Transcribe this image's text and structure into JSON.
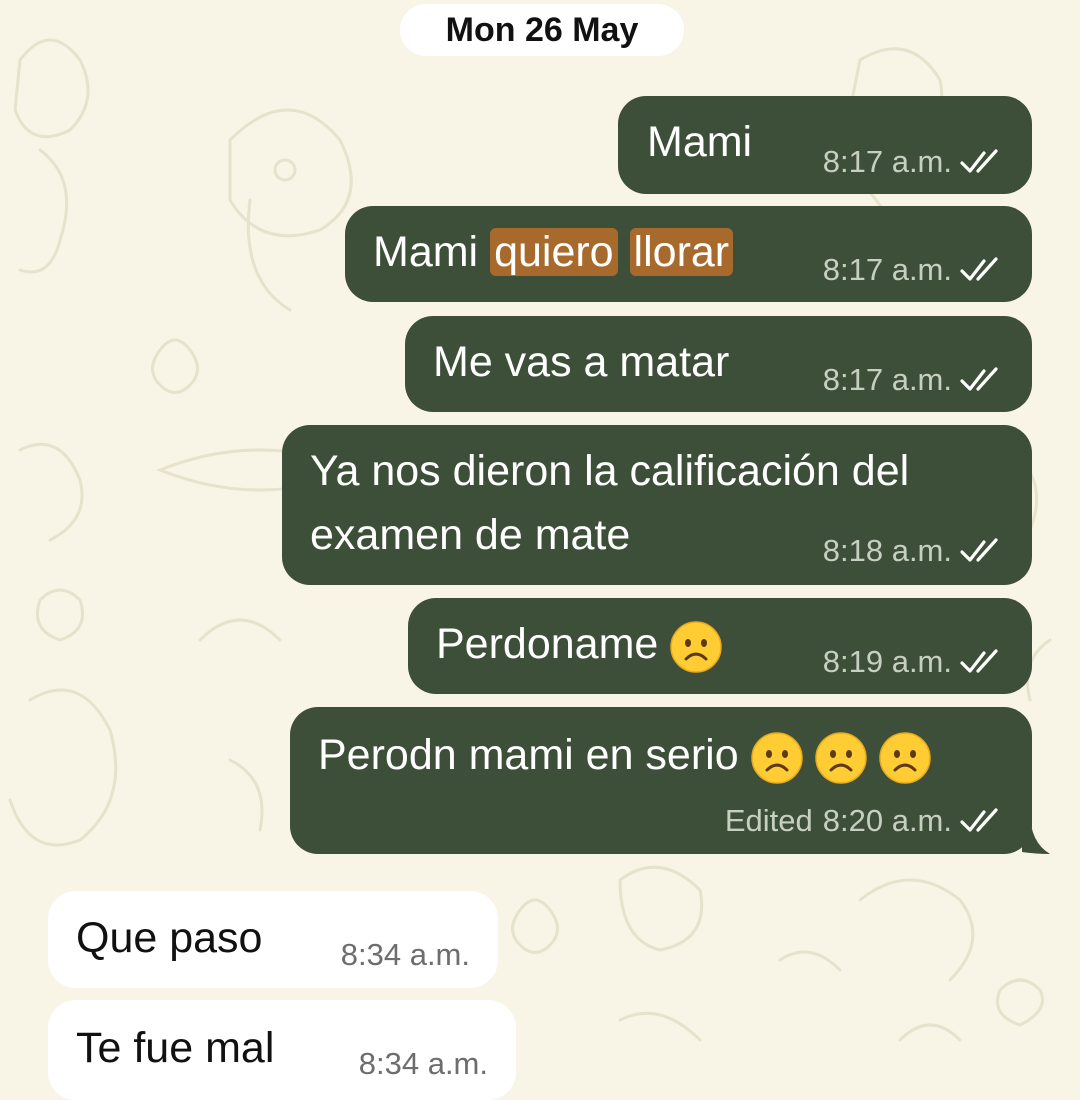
{
  "chat": {
    "date_label": "Mon 26 May",
    "outgoing": [
      {
        "text": "Mami",
        "time": "8:17 a.m.",
        "status": "read-double-check-icon"
      },
      {
        "text_parts": [
          "Mami ",
          "quiero",
          "llorar"
        ],
        "highlighted_words": [
          "quiero",
          "llorar"
        ],
        "time": "8:17 a.m.",
        "status": "read-double-check-icon"
      },
      {
        "text": "Me vas a matar",
        "time": "8:17 a.m.",
        "status": "read-double-check-icon"
      },
      {
        "line1": "Ya nos dieron la calificación del",
        "line2": "examen de mate",
        "time": "8:18 a.m.",
        "status": "read-double-check-icon"
      },
      {
        "text": "Perdoname",
        "emoji": "frowning-face-icon",
        "emoji_count": 1,
        "time": "8:19 a.m.",
        "status": "read-double-check-icon"
      },
      {
        "text": "Perodn mami en serio",
        "emoji": "frowning-face-icon",
        "emoji_count": 3,
        "edited_label": "Edited",
        "time": "8:20 a.m.",
        "status": "read-double-check-icon"
      }
    ],
    "incoming": [
      {
        "text": "Que paso",
        "time": "8:34 a.m."
      },
      {
        "text": "Te fue mal",
        "time": "8:34 a.m."
      }
    ]
  },
  "colors": {
    "wallpaper": "#f8f5e6",
    "outgoing_bubble": "#3e4f39",
    "incoming_bubble": "#ffffff",
    "highlight": "#a86a2c",
    "emoji_face": "#ffcc33"
  }
}
